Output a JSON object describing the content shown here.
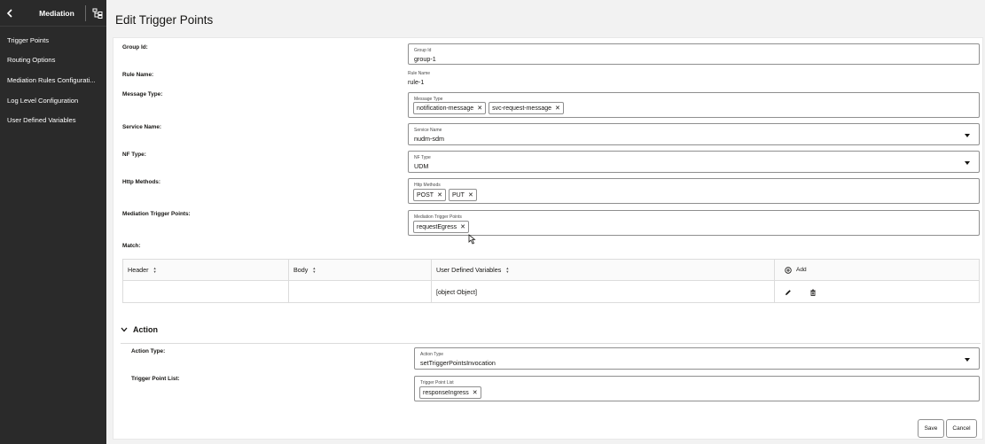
{
  "sidebar": {
    "title": "Mediation",
    "items": [
      {
        "label": "Trigger Points"
      },
      {
        "label": "Routing Options"
      },
      {
        "label": "Mediation Rules Configurati..."
      },
      {
        "label": "Log Level Configuration"
      },
      {
        "label": "User Defined Variables"
      }
    ]
  },
  "page": {
    "title": "Edit Trigger Points"
  },
  "form": {
    "group_id": {
      "row_label": "Group Id:",
      "field_label": "Group Id",
      "value": "group-1"
    },
    "rule_name": {
      "row_label": "Rule Name:",
      "field_label": "Rule Name",
      "value": "rule-1"
    },
    "message_type": {
      "row_label": "Message Type:",
      "field_label": "Message Type",
      "chips": [
        "notification-message",
        "svc-request-message"
      ]
    },
    "service_name": {
      "row_label": "Service Name:",
      "field_label": "Service Name",
      "value": "nudm-sdm"
    },
    "nf_type": {
      "row_label": "NF Type:",
      "field_label": "NF Type",
      "value": "UDM"
    },
    "http_methods": {
      "row_label": "Http Methods:",
      "field_label": "Http Methods",
      "chips": [
        "POST",
        "PUT"
      ]
    },
    "mediation_trigger_points": {
      "row_label": "Mediation Trigger Points:",
      "field_label": "Mediation Trigger Points",
      "chips": [
        "requestEgress"
      ]
    },
    "match": {
      "row_label": "Match:"
    }
  },
  "match_table": {
    "columns": [
      "Header",
      "Body",
      "User Defined Variables"
    ],
    "add_label": "Add",
    "rows": [
      {
        "header": "",
        "body": "",
        "udv": "[object Object]"
      }
    ]
  },
  "action": {
    "section_label": "Action",
    "action_type": {
      "row_label": "Action Type:",
      "field_label": "Action Type",
      "value": "setTriggerPointsInvocation"
    },
    "trigger_point_list": {
      "row_label": "Trigger Point List:",
      "field_label": "Trigger Point List",
      "chips": [
        "responseIngress"
      ]
    }
  },
  "buttons": {
    "save": "Save",
    "cancel": "Cancel"
  },
  "icons": {
    "back": "chevron-left-icon",
    "hierarchy": "hierarchy-icon",
    "sort": "sort-icon",
    "add": "add-circle-icon",
    "edit": "pencil-icon",
    "delete": "trash-icon",
    "collapse": "chevron-down-icon"
  }
}
